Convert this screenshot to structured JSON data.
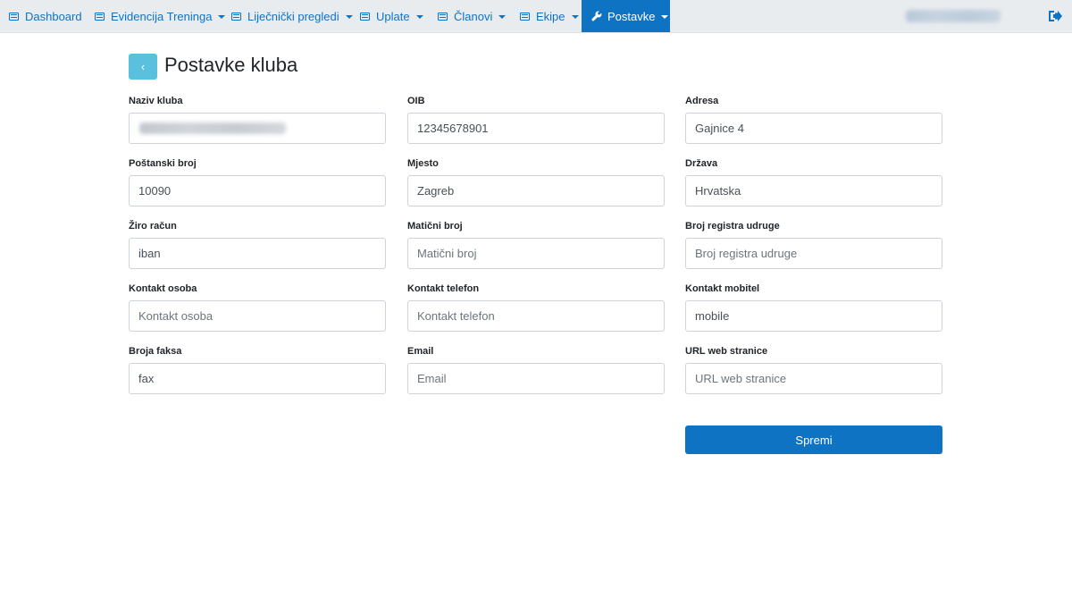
{
  "nav": {
    "items": [
      {
        "label": "Dashboard",
        "icon": "table-icon",
        "dropdown": false
      },
      {
        "label": "Evidencija Treninga",
        "icon": "list-icon",
        "dropdown": true
      },
      {
        "label": "Liječnički pregledi",
        "icon": "list-icon",
        "dropdown": true
      },
      {
        "label": "Uplate",
        "icon": "list-icon",
        "dropdown": true
      },
      {
        "label": "Članovi",
        "icon": "list-icon",
        "dropdown": true
      },
      {
        "label": "Ekipe",
        "icon": "list-icon",
        "dropdown": true
      },
      {
        "label": "Postavke",
        "icon": "wrench-icon",
        "dropdown": true,
        "active": true
      }
    ],
    "logout_icon": "sign-out-icon"
  },
  "page": {
    "title": "Postavke kluba",
    "back_icon": "chevron-left-icon"
  },
  "form": {
    "naziv_kluba": {
      "label": "Naziv kluba",
      "value": "",
      "placeholder": ""
    },
    "oib": {
      "label": "OIB",
      "value": "12345678901",
      "placeholder": "OIB"
    },
    "adresa": {
      "label": "Adresa",
      "value": "Gajnice 4",
      "placeholder": "Adresa"
    },
    "postanski_broj": {
      "label": "Poštanski broj",
      "value": "10090",
      "placeholder": "Poštanski broj"
    },
    "mjesto": {
      "label": "Mjesto",
      "value": "Zagreb",
      "placeholder": "Mjesto"
    },
    "drzava": {
      "label": "Država",
      "value": "Hrvatska",
      "placeholder": "Država"
    },
    "ziro_racun": {
      "label": "Žiro račun",
      "value": "iban",
      "placeholder": "Žiro račun"
    },
    "maticni_broj": {
      "label": "Matični broj",
      "value": "",
      "placeholder": "Matični broj"
    },
    "broj_registra": {
      "label": "Broj registra udruge",
      "value": "",
      "placeholder": "Broj registra udruge"
    },
    "kontakt_osoba": {
      "label": "Kontakt osoba",
      "value": "",
      "placeholder": "Kontakt osoba"
    },
    "kontakt_telefon": {
      "label": "Kontakt telefon",
      "value": "",
      "placeholder": "Kontakt telefon"
    },
    "kontakt_mobitel": {
      "label": "Kontakt mobitel",
      "value": "mobile",
      "placeholder": "Kontakt mobitel"
    },
    "broj_faksa": {
      "label": "Broja faksa",
      "value": "fax",
      "placeholder": "Broja faksa"
    },
    "email": {
      "label": "Email",
      "value": "",
      "placeholder": "Email"
    },
    "url": {
      "label": "URL web stranice",
      "value": "",
      "placeholder": "URL web stranice"
    },
    "save_label": "Spremi"
  },
  "colors": {
    "accent": "#0f73c4",
    "back_button": "#5bc0de",
    "navbar_bg": "#e9ecef"
  }
}
